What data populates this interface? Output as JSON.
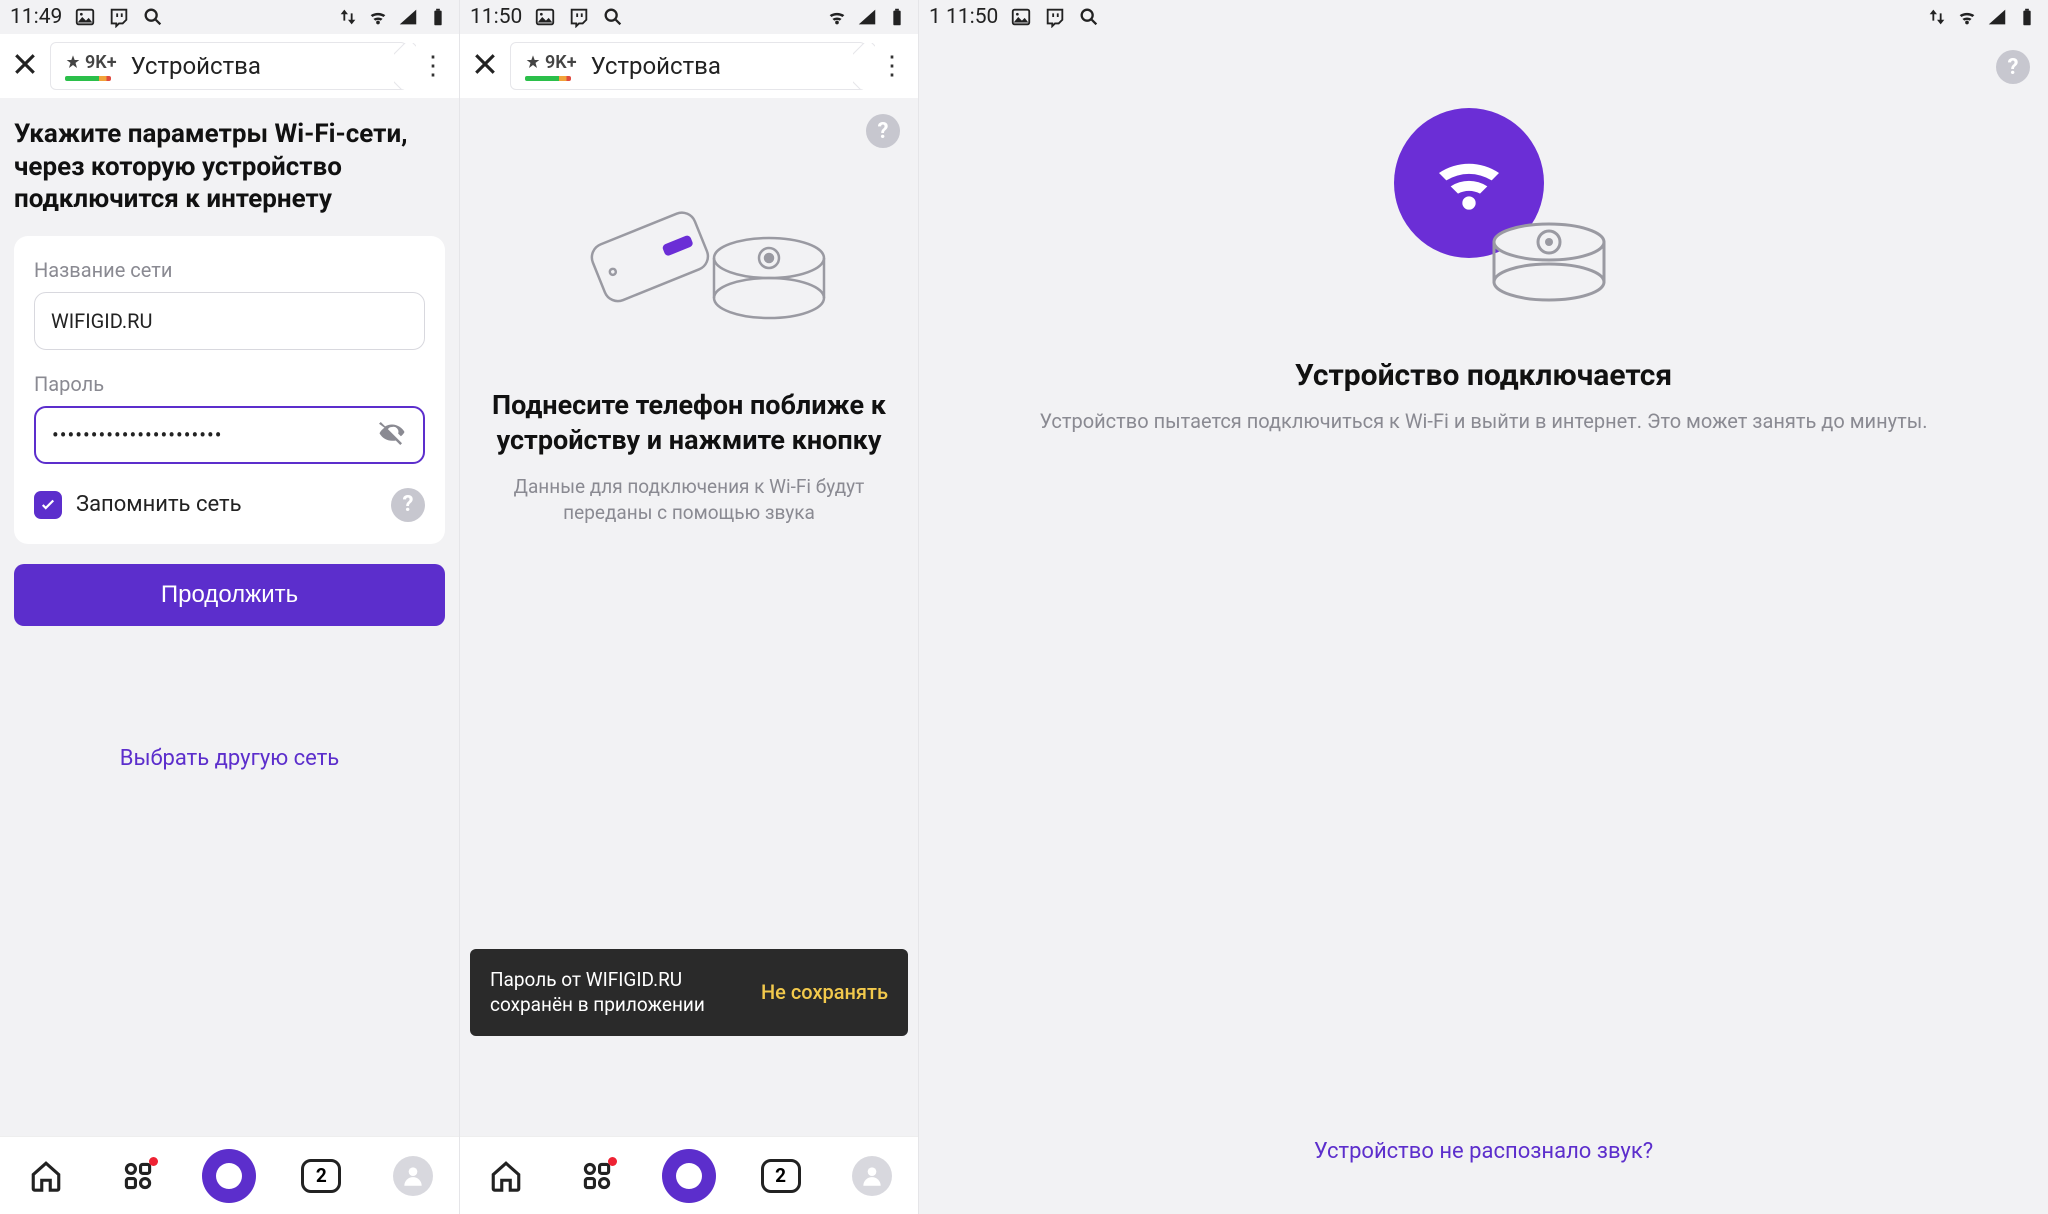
{
  "screens": [
    {
      "status": {
        "time": "11:49"
      },
      "header": {
        "badge": "9K+",
        "title": "Устройства"
      },
      "heading": "Укажите параметры Wi-Fi-сети, через которую устройство подключится к интернету",
      "form": {
        "ssid_label": "Название сети",
        "ssid_value": "WIFIGID.RU",
        "pwd_label": "Пароль",
        "pwd_value": "••••••••••••••••••••••",
        "remember": "Запомнить сеть",
        "cta": "Продолжить",
        "alt_link": "Выбрать другую сеть"
      },
      "nav_count": "2"
    },
    {
      "status": {
        "time": "11:50"
      },
      "header": {
        "badge": "9K+",
        "title": "Устройства"
      },
      "title": "Поднесите телефон поближе к устройству и нажмите кнопку",
      "sub": "Данные для подключения к Wi-Fi будут переданы с помощью звука",
      "snackbar": {
        "line1": "Пароль от WIFIGID.RU",
        "line2": "сохранён в приложении",
        "action": "Не сохранять"
      },
      "nav_count": "2"
    },
    {
      "status": {
        "time_prefix": "1 11:50"
      },
      "title": "Устройство подключается",
      "sub": "Устройство пытается подключиться к Wi-Fi и выйти в интернет. Это может занять до минуты.",
      "link": "Устройство не распознало звук?"
    }
  ]
}
